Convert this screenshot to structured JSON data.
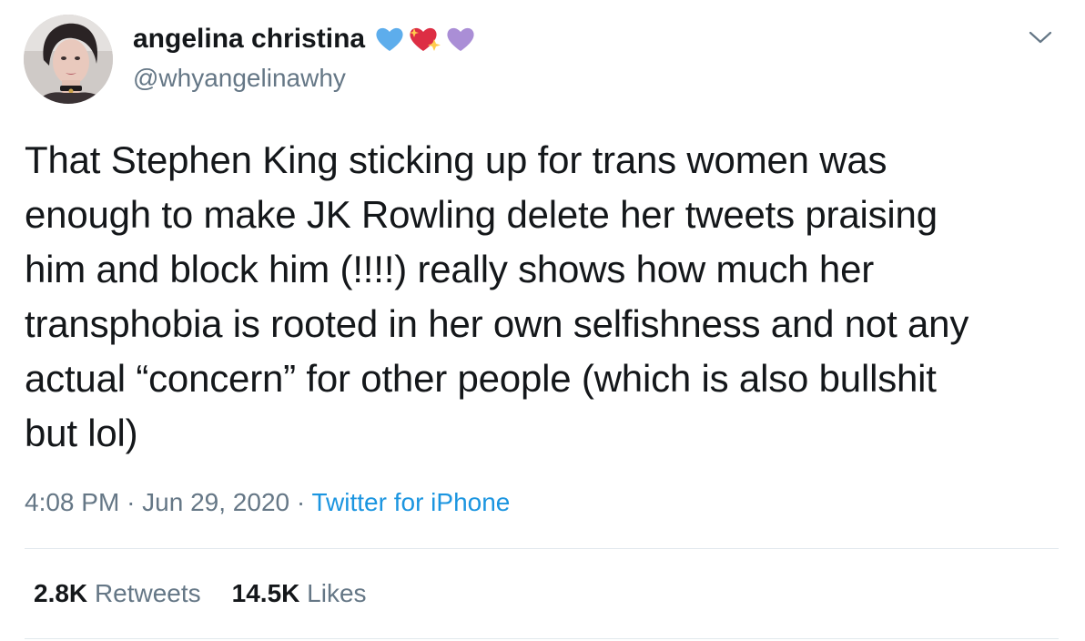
{
  "user": {
    "display_name": "angelina christina",
    "handle": "@whyangelinawhy",
    "emojis": [
      "blue-heart-icon",
      "sparkling-heart-icon",
      "purple-heart-icon"
    ]
  },
  "tweet": {
    "text": "That Stephen King sticking up for trans women was\nenough to make JK Rowling delete her tweets praising\nhim and block him (!!!!) really shows how much her\ntransphobia is rooted in her own selfishness and not any\nactual “concern” for other people (which is also bullshit\nbut lol)",
    "time": "4:08 PM",
    "separator": "·",
    "date": "Jun 29, 2020",
    "source": "Twitter for iPhone"
  },
  "stats": {
    "retweets_count": "2.8K",
    "retweets_label": "Retweets",
    "likes_count": "14.5K",
    "likes_label": "Likes"
  },
  "colors": {
    "text": "#14171a",
    "secondary": "#657786",
    "link": "#1b95e0",
    "divider": "#e1e8ed",
    "blue_heart": "#5dadec",
    "red_heart": "#dd2e44",
    "purple_heart": "#aa8ed6"
  }
}
